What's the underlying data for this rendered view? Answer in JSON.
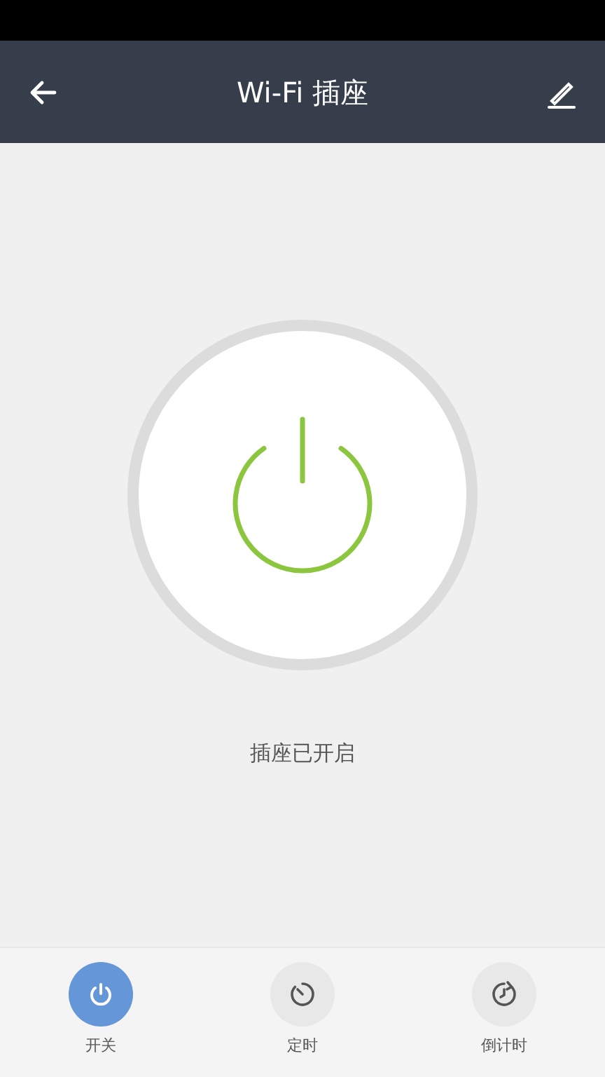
{
  "header": {
    "title": "Wi-Fi 插座"
  },
  "socket": {
    "on": true,
    "status": "插座已开启"
  },
  "tabs": [
    {
      "kind": "power",
      "label": "开关",
      "selected": true
    },
    {
      "kind": "timer",
      "label": "定时",
      "selected": false
    },
    {
      "kind": "countdown",
      "label": "倒计时",
      "selected": false
    }
  ]
}
